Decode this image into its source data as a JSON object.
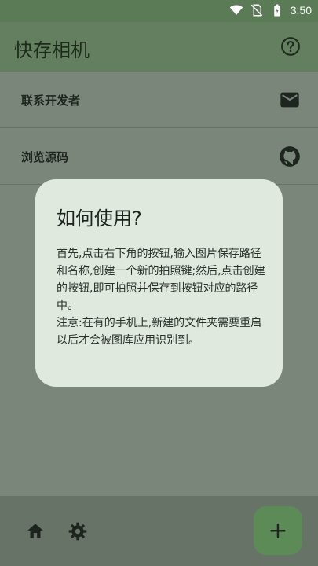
{
  "status_bar": {
    "time": "3:50",
    "icons": [
      "wifi-icon",
      "no-sim-icon",
      "battery-icon"
    ]
  },
  "app_bar": {
    "title": "快存相机",
    "help_icon": "help-circle-icon"
  },
  "list": {
    "items": [
      {
        "label": "联系开发者",
        "icon": "mail-icon"
      },
      {
        "label": "浏览源码",
        "icon": "github-icon"
      }
    ]
  },
  "dialog": {
    "title": "如何使用?",
    "body": "首先,点击右下角的按钮,输入图片保存路径和名称,创建一个新的拍照键;然后,点击创建的按钮,即可拍照并保存到按钮对应的路径中。\n注意:在有的手机上,新建的文件夹需要重启以后才会被图库应用识别到。"
  },
  "bottom_nav": {
    "items": [
      "home-icon",
      "settings-icon"
    ]
  },
  "fab": {
    "label": "+"
  },
  "colors": {
    "scrim": "#7b867b",
    "dialog": "#dfe9de",
    "accent": "#5c8b58"
  }
}
